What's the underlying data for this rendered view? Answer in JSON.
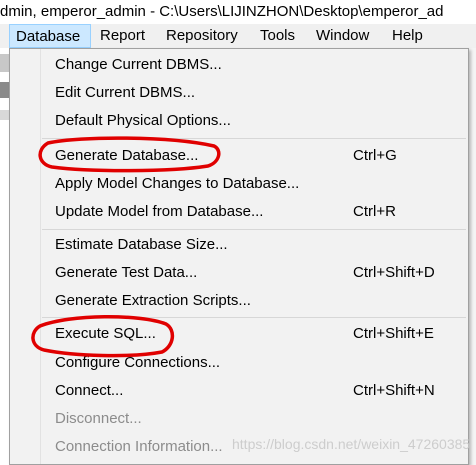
{
  "window": {
    "title": "dmin, emperor_admin - C:\\Users\\LIJINZHON\\Desktop\\emperor_ad"
  },
  "menubar": {
    "items": [
      "Database",
      "Report",
      "Repository",
      "Tools",
      "Window",
      "Help"
    ]
  },
  "dropdown": {
    "items": [
      {
        "label": "Change Current DBMS...",
        "shortcut": ""
      },
      {
        "label": "Edit Current DBMS...",
        "shortcut": ""
      },
      {
        "label": "Default Physical Options...",
        "shortcut": ""
      },
      {
        "label": "Generate Database...",
        "shortcut": "Ctrl+G"
      },
      {
        "label": "Apply Model Changes to Database...",
        "shortcut": ""
      },
      {
        "label": "Update Model from Database...",
        "shortcut": "Ctrl+R"
      },
      {
        "label": "Estimate Database Size...",
        "shortcut": ""
      },
      {
        "label": "Generate Test Data...",
        "shortcut": "Ctrl+Shift+D"
      },
      {
        "label": "Generate Extraction Scripts...",
        "shortcut": ""
      },
      {
        "label": "Execute SQL...",
        "shortcut": "Ctrl+Shift+E"
      },
      {
        "label": "Configure Connections...",
        "shortcut": ""
      },
      {
        "label": "Connect...",
        "shortcut": "Ctrl+Shift+N"
      },
      {
        "label": "Disconnect...",
        "shortcut": ""
      },
      {
        "label": "Connection Information...",
        "shortcut": ""
      }
    ]
  },
  "watermark": "https://blog.csdn.net/weixin_47260385",
  "colors": {
    "menu_active": "#cce8ff",
    "annotation_red": "#e00000",
    "disabled_text": "#8c8c8c"
  }
}
